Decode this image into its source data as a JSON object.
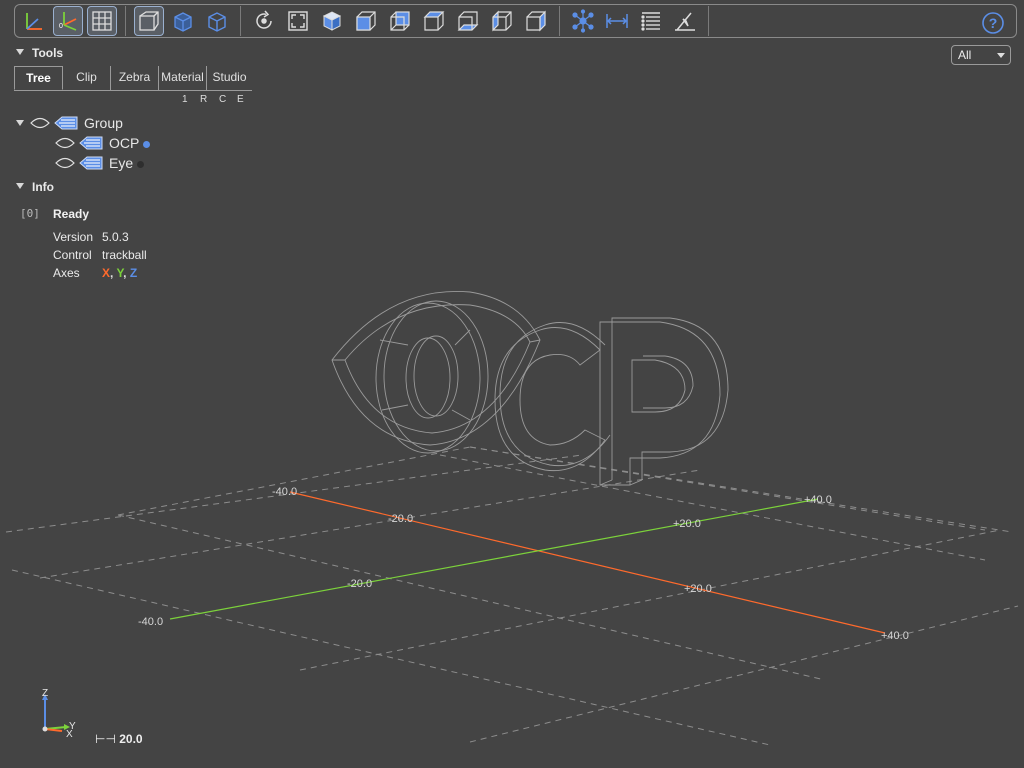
{
  "view_select": {
    "value": "All"
  },
  "tools": {
    "header": "Tools",
    "tabs": [
      {
        "label": "Tree",
        "active": true
      },
      {
        "label": "Clip"
      },
      {
        "label": "Zebra"
      },
      {
        "label": "Material"
      },
      {
        "label": "Studio"
      }
    ],
    "collapse_buttons": [
      "1",
      "R",
      "C",
      "E"
    ]
  },
  "tree": {
    "group": {
      "label": "Group"
    },
    "children": [
      {
        "label": "OCP",
        "dot_color": "#5b8ee6"
      },
      {
        "label": "Eye",
        "dot_color": "#2e2e2e"
      }
    ]
  },
  "info": {
    "header": "Info",
    "index": "[0]",
    "status": "Ready",
    "version_key": "Version",
    "version_value": "5.0.3",
    "control_key": "Control",
    "control_value": "trackball",
    "axes_key": "Axes",
    "axes": {
      "x": "X",
      "y": "Y",
      "z": "Z",
      "sep": ", ",
      "x_color": "#ff6a2c",
      "y_color": "#7cd23b",
      "z_color": "#5b8ee6"
    }
  },
  "grid_labels": {
    "x_neg40": "-40.0",
    "x_neg20": "-20.0",
    "x_pos20": "+20.0",
    "x_pos40": "+40.0",
    "y_neg40": "-40.0",
    "y_neg20": "-20.0",
    "y_pos20": "+20.0",
    "y_pos40": "+40.0"
  },
  "gizmo": {
    "z": "Z",
    "y": "Y",
    "x": "X"
  },
  "scale_value": "20.0",
  "colors": {
    "background": "#444444",
    "x_axis": "#ff6a2c",
    "y_axis": "#7cd23b",
    "accent": "#5b8ee6"
  }
}
